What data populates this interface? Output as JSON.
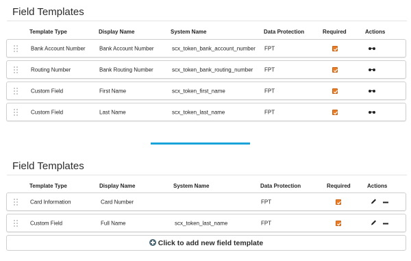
{
  "section1": {
    "title": "Field Templates",
    "headers": {
      "template_type": "Template Type",
      "display_name": "Display Name",
      "system_name": "System Name",
      "data_protection": "Data Protection",
      "required": "Required",
      "actions": "Actions"
    },
    "rows": [
      {
        "template_type": "Bank Account Number",
        "display_name": "Bank Account Number",
        "system_name": "scx_token_bank_account_number",
        "data_protection": "FPT",
        "required": true
      },
      {
        "template_type": "Routing Number",
        "display_name": "Bank Routing Number",
        "system_name": "scx_token_bank_routing_number",
        "data_protection": "FPT",
        "required": true
      },
      {
        "template_type": "Custom Field",
        "display_name": "First Name",
        "system_name": "scx_token_first_name",
        "data_protection": "FPT",
        "required": true
      },
      {
        "template_type": "Custom Field",
        "display_name": "Last Name",
        "system_name": "scx_token_last_name",
        "data_protection": "FPT",
        "required": true
      }
    ],
    "row_action_icon": "view-glasses-icon"
  },
  "section2": {
    "title": "Field Templates",
    "headers": {
      "template_type": "Template Type",
      "display_name": "Display Name",
      "system_name": "System Name",
      "data_protection": "Data Protection",
      "required": "Required",
      "actions": "Actions"
    },
    "rows": [
      {
        "template_type": "Card Information",
        "display_name": "Card Number",
        "system_name": "",
        "data_protection": "FPT",
        "required": true
      },
      {
        "template_type": "Custom Field",
        "display_name": "Full Name",
        "system_name": "scx_token_last_name",
        "data_protection": "FPT",
        "required": true
      }
    ],
    "row_action_icons": [
      "edit-pencil-icon",
      "remove-minus-icon"
    ],
    "add_label": "Click to add new field template"
  },
  "colors": {
    "accent_blue": "#1aa3d8",
    "checkbox_orange": "#e97d27",
    "add_icon": "#4a6878"
  }
}
